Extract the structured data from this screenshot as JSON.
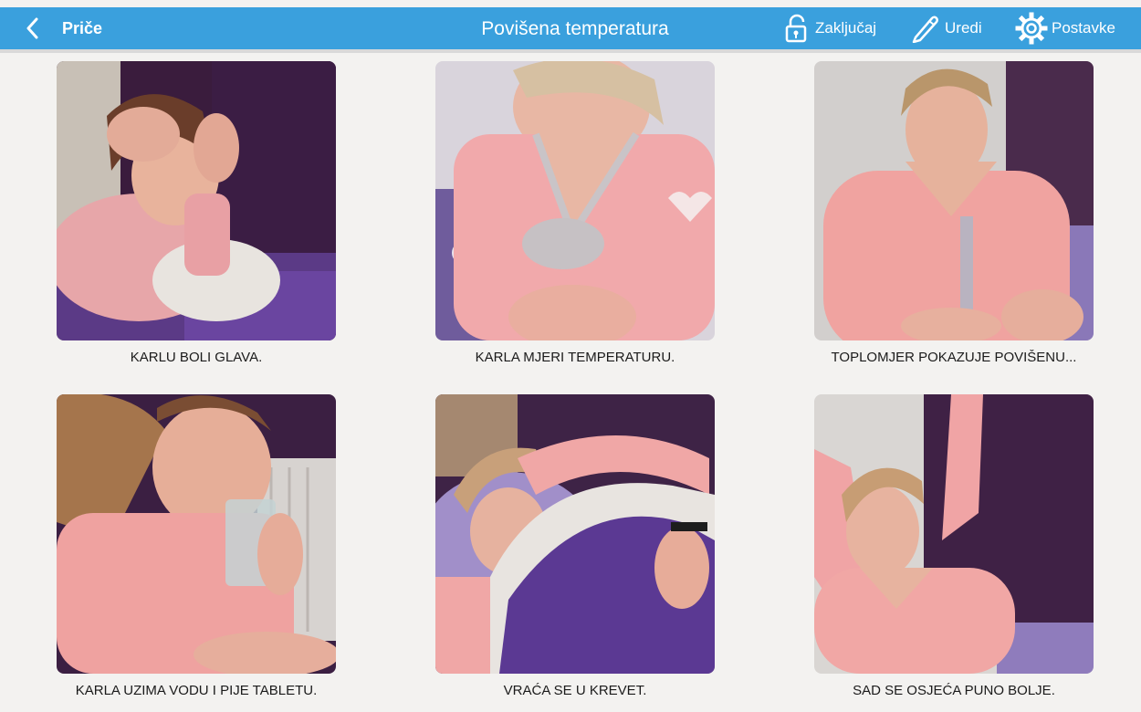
{
  "header": {
    "back_label": "Priče",
    "title": "Povišena temperatura",
    "lock_label": "Zaključaj",
    "edit_label": "Uredi",
    "settings_label": "Postavke",
    "icons": [
      "chevron-left-icon",
      "unlock-icon",
      "pencil-icon",
      "gear-icon"
    ],
    "bar_color": "#3aa0dd"
  },
  "cards": [
    {
      "caption": "KARLU BOLI GLAVA.",
      "image": "woman-holding-head-photo"
    },
    {
      "caption": "KARLA MJERI TEMPERATURU.",
      "image": "woman-placing-thermometer-photo"
    },
    {
      "caption": "TOPLOMJER POKAZUJE POVIŠENU...",
      "image": "woman-reading-thermometer-photo"
    },
    {
      "caption": "KARLA UZIMA VODU I PIJE TABLETU.",
      "image": "woman-drinking-water-photo"
    },
    {
      "caption": "VRAĆA SE U KREVET.",
      "image": "woman-lying-in-bed-photo"
    },
    {
      "caption": "SAD SE OSJEĆA PUNO BOLJE.",
      "image": "woman-stretching-photo"
    }
  ]
}
